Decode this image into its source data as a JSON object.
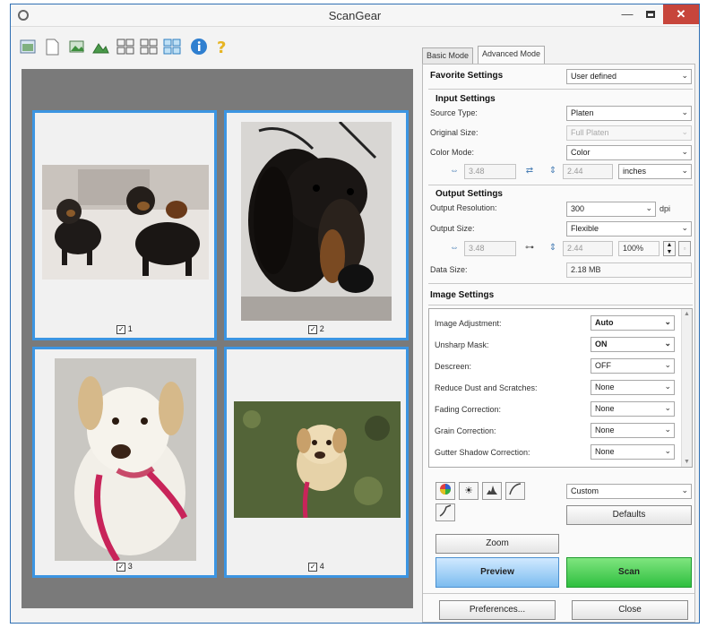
{
  "window": {
    "title": "ScanGear"
  },
  "thumbnails": [
    {
      "number": "1",
      "checked": true
    },
    {
      "number": "2",
      "checked": true
    },
    {
      "number": "3",
      "checked": true
    },
    {
      "number": "4",
      "checked": true
    }
  ],
  "tabs": {
    "basic": "Basic Mode",
    "advanced": "Advanced Mode"
  },
  "favorite": {
    "label": "Favorite Settings",
    "value": "User defined"
  },
  "input": {
    "heading": "Input Settings",
    "source_type_label": "Source Type:",
    "source_type_value": "Platen",
    "original_size_label": "Original Size:",
    "original_size_value": "Full Platen",
    "color_mode_label": "Color Mode:",
    "color_mode_value": "Color",
    "width_value": "3.48",
    "height_value": "2.44",
    "unit_value": "inches"
  },
  "output": {
    "heading": "Output Settings",
    "resolution_label": "Output Resolution:",
    "resolution_value": "300",
    "resolution_unit": "dpi",
    "size_label": "Output Size:",
    "size_value": "Flexible",
    "width_value": "3.48",
    "height_value": "2.44",
    "scale_value": "100%",
    "data_size_label": "Data Size:",
    "data_size_value": "2.18 MB"
  },
  "image_settings": {
    "heading": "Image Settings",
    "rows": [
      {
        "label": "Image Adjustment:",
        "value": "Auto"
      },
      {
        "label": "Unsharp Mask:",
        "value": "ON"
      },
      {
        "label": "Descreen:",
        "value": "OFF"
      },
      {
        "label": "Reduce Dust and Scratches:",
        "value": "None"
      },
      {
        "label": "Fading Correction:",
        "value": "None"
      },
      {
        "label": "Grain Correction:",
        "value": "None"
      },
      {
        "label": "Gutter Shadow Correction:",
        "value": "None"
      }
    ]
  },
  "tone": {
    "preset_value": "Custom",
    "defaults_label": "Defaults"
  },
  "buttons": {
    "zoom": "Zoom",
    "preview": "Preview",
    "scan": "Scan",
    "preferences": "Preferences...",
    "close": "Close"
  },
  "colors": {
    "accent": "#3c95e2",
    "close_red": "#c7453b",
    "scan_green": "#2fbf3f",
    "preview_blue": "#7cbcef"
  }
}
